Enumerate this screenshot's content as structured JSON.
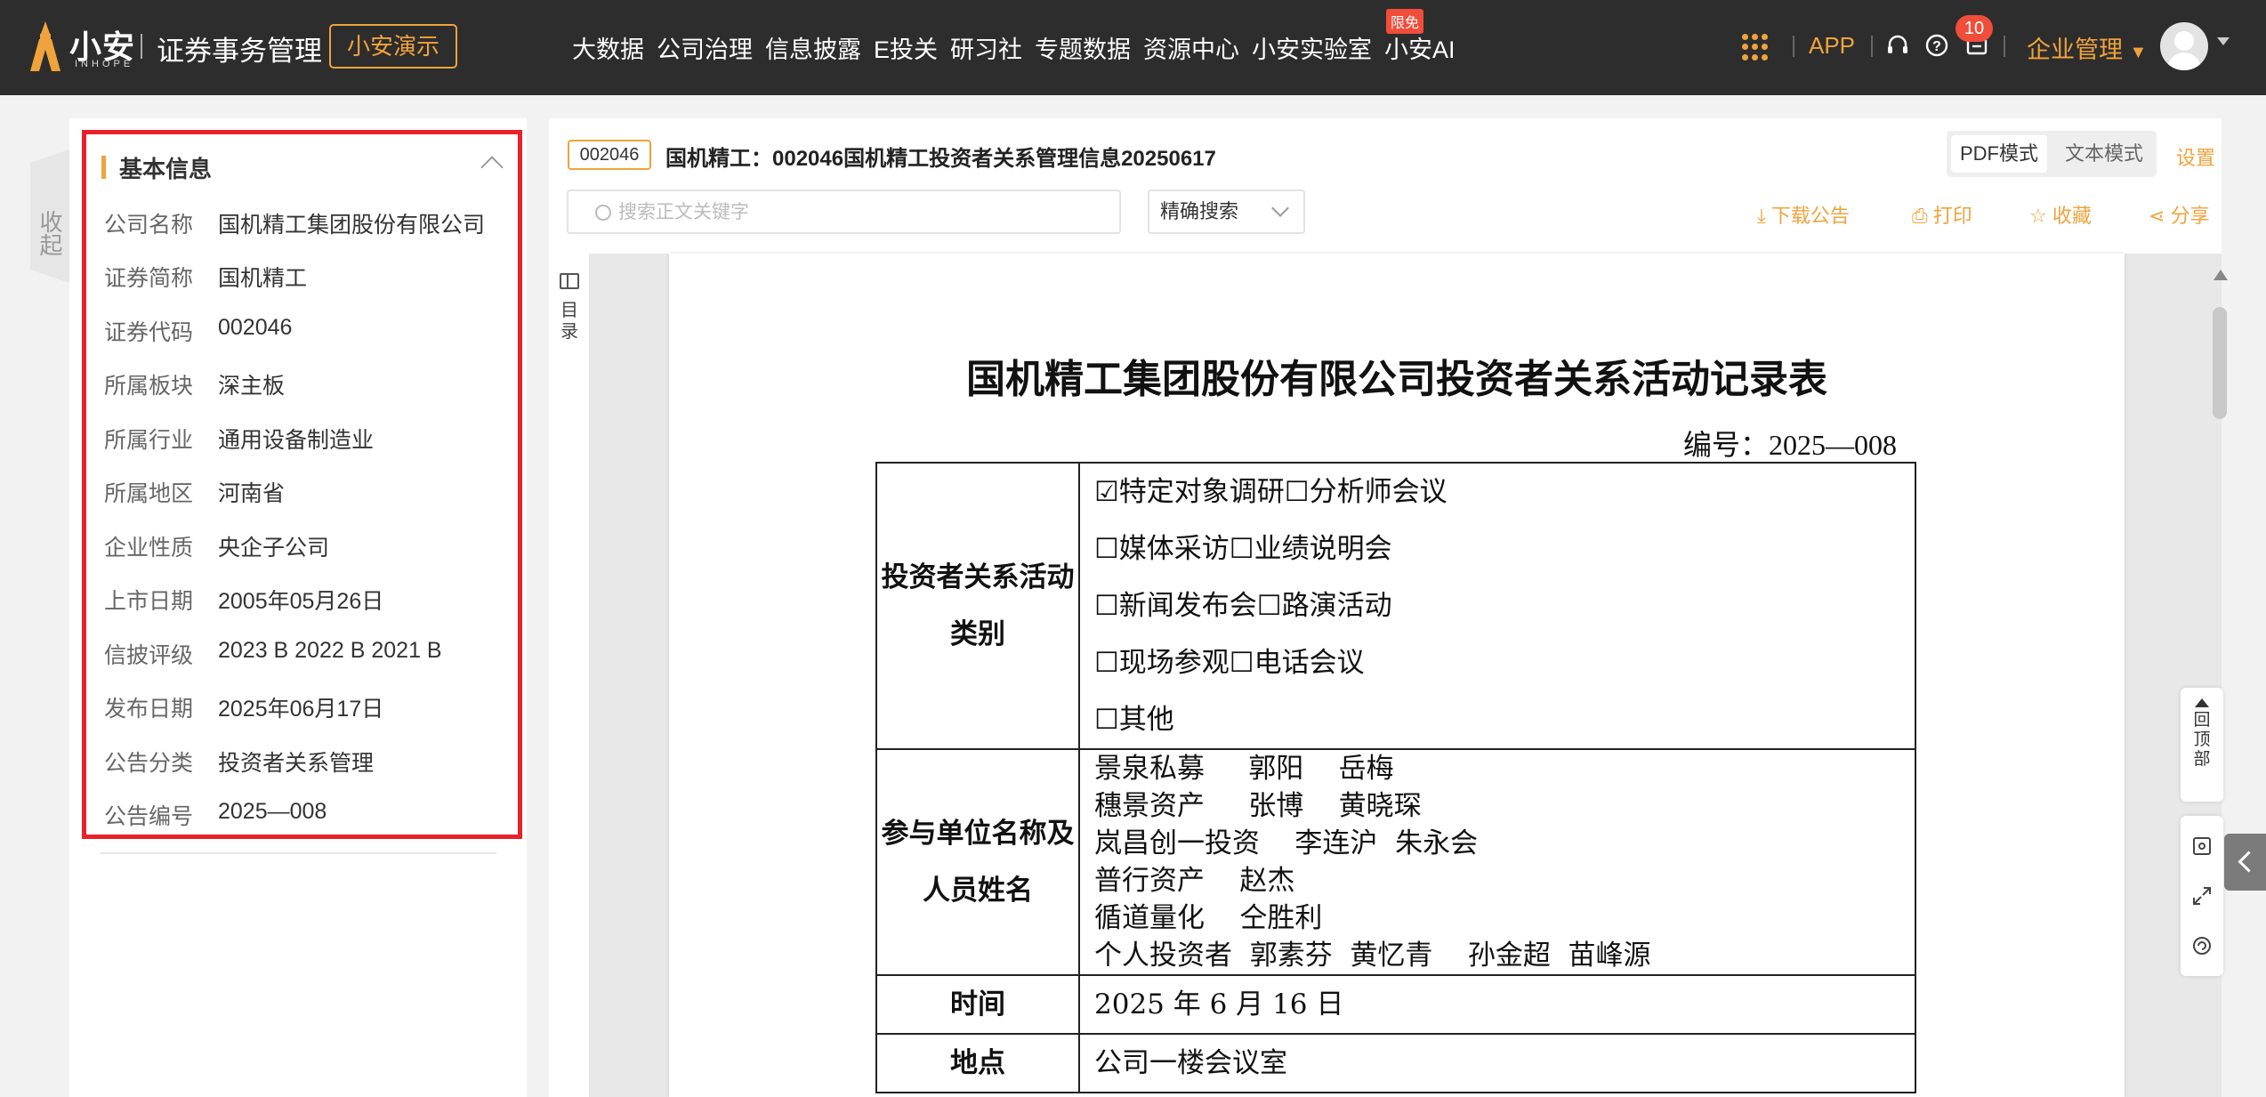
{
  "header": {
    "logo_text": "小安",
    "logo_sub": "INHOPE",
    "product_name": "证券事务管理",
    "demo_button": "小安演示",
    "nav": [
      "大数据",
      "公司治理",
      "信息披露",
      "E投关",
      "研习社",
      "专题数据",
      "资源中心",
      "小安实验室",
      "小安AI"
    ],
    "nav_badge": "限免",
    "app_link": "APP",
    "message_count": "10",
    "enterprise_menu": "企业管理",
    "icons": [
      "apps-grid-icon",
      "headset-icon",
      "help-icon",
      "message-icon",
      "avatar-icon"
    ]
  },
  "sidebar": {
    "collapse_label": "收起",
    "section_title": "基本信息",
    "fields": [
      {
        "key": "公司名称",
        "value": "国机精工集团股份有限公司"
      },
      {
        "key": "证券简称",
        "value": "国机精工"
      },
      {
        "key": "证券代码",
        "value": "002046"
      },
      {
        "key": "所属板块",
        "value": "深主板"
      },
      {
        "key": "所属行业",
        "value": "通用设备制造业"
      },
      {
        "key": "所属地区",
        "value": "河南省"
      },
      {
        "key": "企业性质",
        "value": "央企子公司"
      },
      {
        "key": "上市日期",
        "value": "2005年05月26日"
      },
      {
        "key": "信披评级",
        "value": "2023 B  2022 B  2021 B"
      },
      {
        "key": "发布日期",
        "value": "2025年06月17日"
      },
      {
        "key": "公告分类",
        "value": "投资者关系管理"
      },
      {
        "key": "公告编号",
        "value": "2025—008"
      }
    ],
    "highlight_color": "#e8212b"
  },
  "doc_header": {
    "code": "002046",
    "title": "国机精工：002046国机精工投资者关系管理信息20250617",
    "mode_pdf": "PDF模式",
    "mode_text": "文本模式",
    "settings": "设置",
    "search_placeholder": "搜索正文关键字",
    "search_mode": "精确搜索",
    "actions": {
      "download": "下载公告",
      "print": "打印",
      "favorite": "收藏",
      "share": "分享"
    }
  },
  "viewer": {
    "toc_label": "目录",
    "back_to_top": "回顶部"
  },
  "document": {
    "title": "国机精工集团股份有限公司投资者关系活动记录表",
    "number": "编号：2025—008",
    "activity_label": "投资者关系活动类别",
    "activity_options": [
      "☑特定对象调研☐分析师会议",
      "☐媒体采访☐业绩说明会",
      "☐新闻发布会☐路演活动",
      "☐现场参观☐电话会议",
      "☐其他"
    ],
    "participants_label": "参与单位名称及人员姓名",
    "participants": [
      "景泉私募     郭阳    岳梅",
      "穗景资产     张博    黄晓琛",
      "岚昌创一投资    李连沪  朱永会",
      "普行资产    赵杰",
      "循道量化    仝胜利",
      "个人投资者  郭素芬  黄忆青    孙金超  苗峰源"
    ],
    "time_label": "时间",
    "time_value": "2025 年 6 月 16 日",
    "place_label": "地点",
    "place_value": "公司一楼会议室"
  },
  "colors": {
    "accent": "#f0a33c",
    "topbar": "#2d2d2d",
    "badge": "#f04d3a"
  }
}
